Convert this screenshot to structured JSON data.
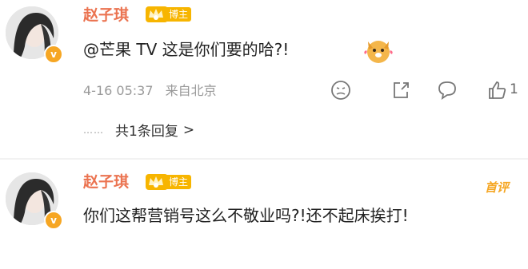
{
  "comments": [
    {
      "author": "赵子琪",
      "badge_label": "博主",
      "text": "@芒果 TV 这是你们要的哈?!",
      "date": "4-16 05:37",
      "location": "来自北京",
      "likes": "1",
      "replies_label": "共1条回复",
      "replies_chevron": ">",
      "replies_dots": "……",
      "verified_mark": "v"
    },
    {
      "author": "赵子琪",
      "badge_label": "博主",
      "text": "你们这帮营销号这么不敬业吗?!还不起床挨打!",
      "first_comment_tag": "首评",
      "verified_mark": "v"
    }
  ],
  "colors": {
    "author": "#eb7350",
    "badge": "#f7b500",
    "meta": "#999999",
    "first_tag": "#f5a623"
  }
}
